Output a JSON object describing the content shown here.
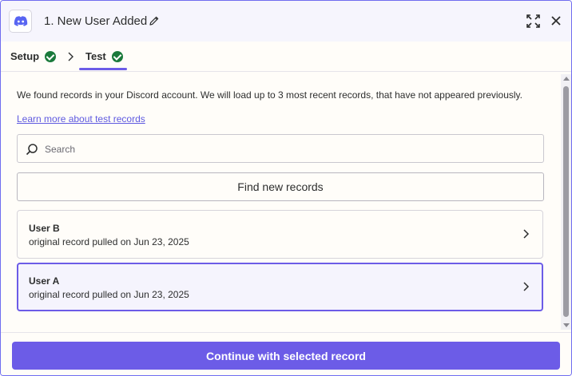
{
  "header": {
    "title": "1. New User Added",
    "app_icon": "discord-icon",
    "edit_icon": "pencil-icon",
    "expand_icon": "expand-icon",
    "close_icon": "close-icon"
  },
  "tabs": [
    {
      "label": "Setup",
      "status_icon": "check-circle-icon"
    },
    {
      "label": "Test",
      "status_icon": "check-circle-icon",
      "active": true
    }
  ],
  "content": {
    "description": "We found records in your Discord account. We will load up to 3 most recent records, that have not appeared previously.",
    "learn_more": "Learn more about test records",
    "search": {
      "placeholder": "Search",
      "value": ""
    },
    "find_button": "Find new records",
    "records": [
      {
        "name": "User B",
        "subtitle": "original record pulled on Jun 23, 2025",
        "selected": false
      },
      {
        "name": "User A",
        "subtitle": "original record pulled on Jun 23, 2025",
        "selected": true
      }
    ]
  },
  "footer": {
    "continue_button": "Continue with selected record"
  },
  "colors": {
    "accent": "#6c5ce7",
    "success": "#1a7a3b",
    "discord": "#5865f2",
    "link": "#5f5ae0"
  }
}
